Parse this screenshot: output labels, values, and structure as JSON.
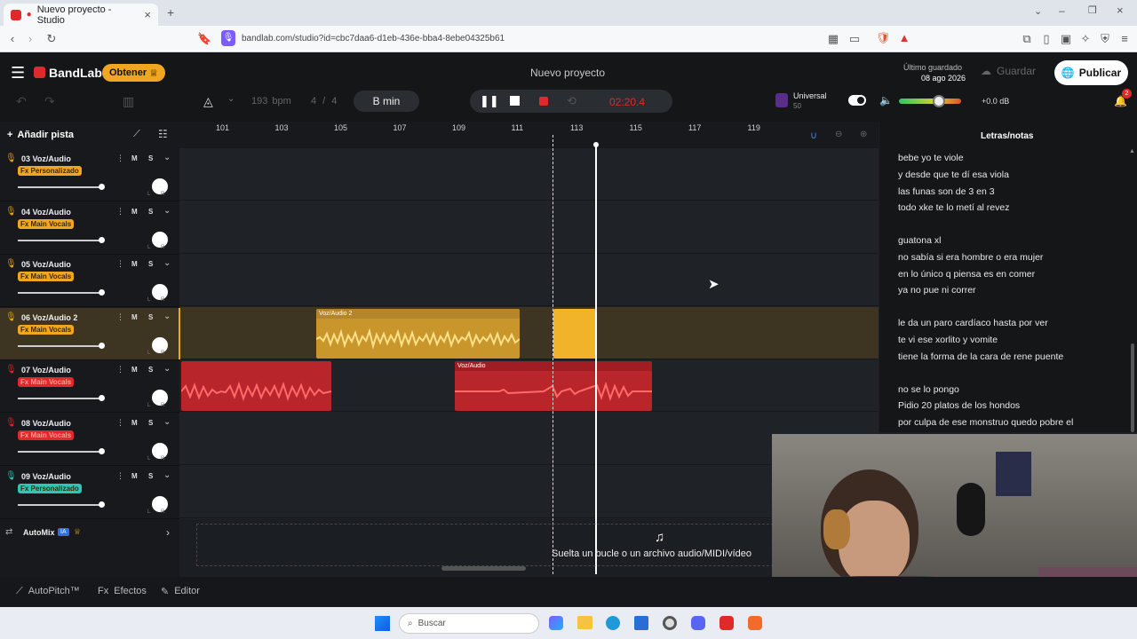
{
  "browser": {
    "tab_title": "Nuevo proyecto - Studio",
    "url": "bandlab.com/studio?id=cbc7daa6-d1eb-436e-bba4-8ebe04325b61"
  },
  "app": {
    "logo": "BandLab",
    "obtener": "Obtener",
    "project_title": "Nuevo proyecto",
    "last_saved_label": "Último guardado",
    "last_saved_date": "08 ago 2026",
    "guardar": "Guardar",
    "publicar": "Publicar"
  },
  "toolbar": {
    "bpm_value": "193",
    "bpm_unit": "bpm",
    "time_sig_num": "4",
    "time_sig_slash": "/",
    "time_sig_den": "4",
    "key": "B min",
    "time": "02:20.4",
    "instrument_name": "Universal",
    "instrument_sub": "50",
    "volume_db": "+0.0 dB",
    "notif_count": "2",
    "master_volume_level": 0.62
  },
  "add_track": "Añadir pista",
  "tracks": [
    {
      "name": "03  Voz/Audio",
      "fx": "Fx Personalizado",
      "fx_color": "#f0a620",
      "icon_color": "#f0a620",
      "active": false
    },
    {
      "name": "04  Voz/Audio",
      "fx": "Fx Main Vocals",
      "fx_color": "#f0a620",
      "icon_color": "#f0a620",
      "active": false
    },
    {
      "name": "05  Voz/Audio",
      "fx": "Fx Main Vocals",
      "fx_color": "#f0a620",
      "icon_color": "#f0a620",
      "active": false
    },
    {
      "name": "06  Voz/Audio 2",
      "fx": "Fx Main Vocals",
      "fx_color": "#f0a620",
      "icon_color": "#f0a620",
      "active": true
    },
    {
      "name": "07  Voz/Audio",
      "fx": "Fx Main Vocals",
      "fx_color": "#e02a2a",
      "icon_color": "#e02a2a",
      "active": false
    },
    {
      "name": "08  Voz/Audio",
      "fx": "Fx Main Vocals",
      "fx_color": "#e02a2a",
      "icon_color": "#e02a2a",
      "active": false
    },
    {
      "name": "09  Voz/Audio",
      "fx": "Fx Personalizado",
      "fx_color": "#2ec7b5",
      "icon_color": "#2ec7b5",
      "active": false
    }
  ],
  "mute_label": "M",
  "solo_label": "S",
  "automix": {
    "label": "AutoMix",
    "badge": "IA"
  },
  "ruler": [
    "101",
    "103",
    "105",
    "107",
    "109",
    "111",
    "113",
    "115",
    "117",
    "119"
  ],
  "clips": {
    "c1": "Voz/Audio 2",
    "c2": "Voz/Audio"
  },
  "dropzone_text": "Suelta un bucle o un archivo audio/MIDI/vídeo",
  "lyrics": {
    "title": "Letras/notas",
    "lines": [
      "bebe yo te viole",
      "y desde que te dí esa viola",
      "las funas son de 3 en 3",
      "todo xke te lo metí al revez",
      "guatona xl",
      "no sabía si era hombre o era mujer",
      "en lo único q piensa es en comer",
      "ya no pue ni correr",
      "le da un paro cardíaco hasta por ver",
      "te vi ese xorlito y vomite",
      "tiene la forma de la cara de rene puente",
      "no se lo pongo",
      "Pidio 20 platos de los hondos",
      "por culpa de ese monstruo quedo pobre el"
    ]
  },
  "bottom": {
    "autopitch": "AutoPitch™",
    "efectos": "Efectos",
    "editor": "Editor"
  },
  "taskbar": {
    "search": "Buscar"
  },
  "colors": {
    "accent": "#f0a620",
    "red": "#e02a2a",
    "teal": "#2ec7b5",
    "playhead": "#ffffff"
  }
}
